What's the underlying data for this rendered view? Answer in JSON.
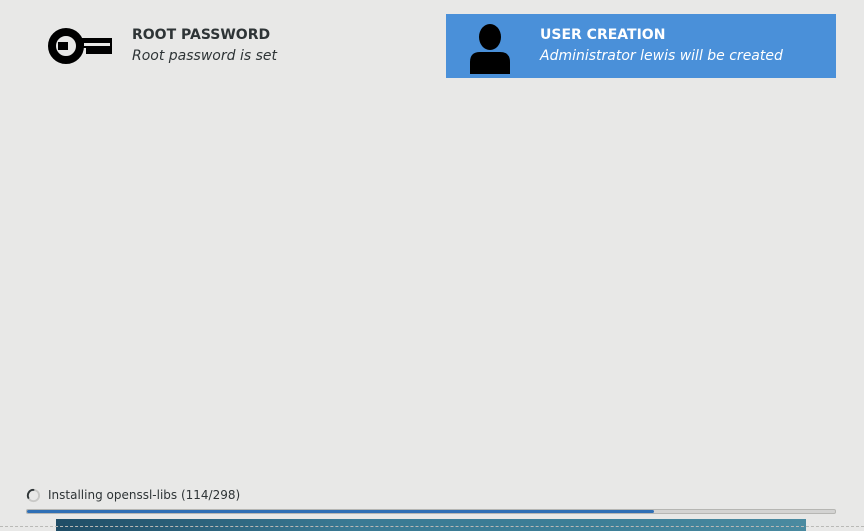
{
  "spokes": {
    "root_password": {
      "title": "ROOT PASSWORD",
      "status": "Root password is set",
      "icon": "key-icon"
    },
    "user_creation": {
      "title": "USER CREATION",
      "status": "Administrator lewis will be created",
      "icon": "user-icon",
      "selected": true
    }
  },
  "progress": {
    "text": "Installing openssl-libs (114/298)",
    "current": 114,
    "total": 298,
    "fraction": 0.776
  },
  "colors": {
    "background": "#e8e8e7",
    "selected_spoke": "#4a90d9",
    "progress_fill": "#2f6fb5",
    "text": "#2e3436"
  }
}
